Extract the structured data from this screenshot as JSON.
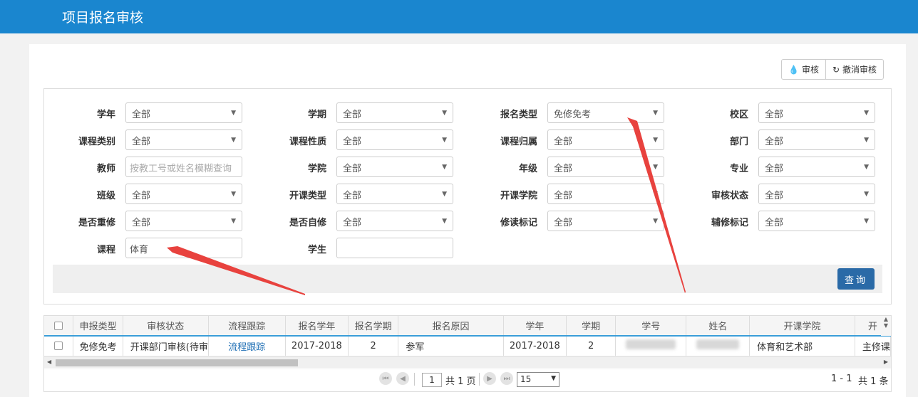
{
  "header": {
    "title": "项目报名审核"
  },
  "toolbar": {
    "audit_label": "审核",
    "cancel_audit_label": "撤消审核"
  },
  "filters": {
    "academic_year": {
      "label": "学年",
      "value": "全部"
    },
    "semester": {
      "label": "学期",
      "value": "全部"
    },
    "enroll_type": {
      "label": "报名类型",
      "value": "免修免考"
    },
    "campus": {
      "label": "校区",
      "value": "全部"
    },
    "course_category": {
      "label": "课程类别",
      "value": "全部"
    },
    "course_nature": {
      "label": "课程性质",
      "value": "全部"
    },
    "course_owner": {
      "label": "课程归属",
      "value": "全部"
    },
    "department": {
      "label": "部门",
      "value": "全部"
    },
    "teacher": {
      "label": "教师",
      "placeholder": "按教工号或姓名模糊查询"
    },
    "college": {
      "label": "学院",
      "value": "全部"
    },
    "grade": {
      "label": "年级",
      "value": "全部"
    },
    "major": {
      "label": "专业",
      "value": "全部"
    },
    "class": {
      "label": "班级",
      "value": "全部"
    },
    "offering_type": {
      "label": "开课类型",
      "value": "全部"
    },
    "offering_college": {
      "label": "开课学院",
      "value": "全部"
    },
    "audit_status": {
      "label": "审核状态",
      "value": "全部"
    },
    "is_retake": {
      "label": "是否重修",
      "value": "全部"
    },
    "is_self_study": {
      "label": "是否自修",
      "value": "全部"
    },
    "study_mark": {
      "label": "修读标记",
      "value": "全部"
    },
    "minor_mark": {
      "label": "辅修标记",
      "value": "全部"
    },
    "course": {
      "label": "课程",
      "value": "体育"
    },
    "student": {
      "label": "学生",
      "value": ""
    }
  },
  "query_label": "查询",
  "grid": {
    "columns": [
      "申报类型",
      "审核状态",
      "流程跟踪",
      "报名学年",
      "报名学期",
      "报名原因",
      "学年",
      "学期",
      "学号",
      "姓名",
      "开课学院",
      "开"
    ],
    "rows": [
      {
        "enroll_type": "免修免考",
        "audit_status": "开课部门审核(待审",
        "track": "流程跟踪",
        "enroll_year": "2017-2018",
        "enroll_term": "2",
        "reason": "参军",
        "year": "2017-2018",
        "term": "2",
        "student_id": "",
        "name": "",
        "offering_college": "体育和艺术部",
        "last": "主修课"
      }
    ]
  },
  "pager": {
    "current_page": "1",
    "total_pages_text": "共 1 页",
    "page_size": "15",
    "range_text": "1 - 1",
    "total_text": "共 1 条"
  },
  "annotation_color": "#e8423e"
}
